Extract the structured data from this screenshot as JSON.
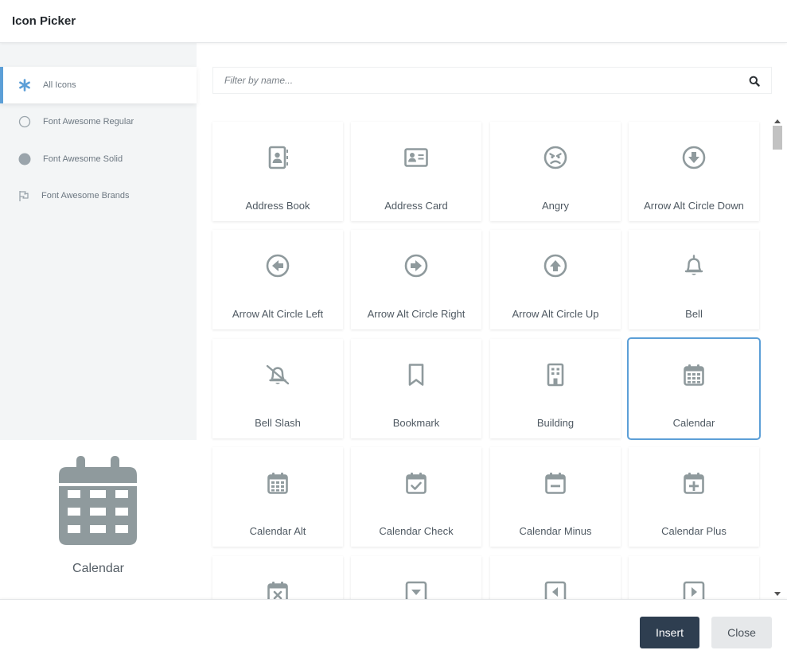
{
  "header": {
    "title": "Icon Picker"
  },
  "sidebar": {
    "items": [
      {
        "label": "All Icons",
        "icon": "asterisk-icon",
        "active": true
      },
      {
        "label": "Font Awesome Regular",
        "icon": "circle-outline-icon",
        "active": false
      },
      {
        "label": "Font Awesome Solid",
        "icon": "circle-solid-icon",
        "active": false
      },
      {
        "label": "Font Awesome Brands",
        "icon": "flag-icon",
        "active": false
      }
    ]
  },
  "preview": {
    "icon": "calendar-icon",
    "name": "Calendar"
  },
  "search": {
    "placeholder": "Filter by name...",
    "value": ""
  },
  "icons": [
    {
      "label": "Address Book",
      "icon": "address-book-icon"
    },
    {
      "label": "Address Card",
      "icon": "address-card-icon"
    },
    {
      "label": "Angry",
      "icon": "angry-icon"
    },
    {
      "label": "Arrow Alt Circle Down",
      "icon": "arrow-alt-circle-down-icon"
    },
    {
      "label": "Arrow Alt Circle Left",
      "icon": "arrow-alt-circle-left-icon"
    },
    {
      "label": "Arrow Alt Circle Right",
      "icon": "arrow-alt-circle-right-icon"
    },
    {
      "label": "Arrow Alt Circle Up",
      "icon": "arrow-alt-circle-up-icon"
    },
    {
      "label": "Bell",
      "icon": "bell-icon"
    },
    {
      "label": "Bell Slash",
      "icon": "bell-slash-icon"
    },
    {
      "label": "Bookmark",
      "icon": "bookmark-icon"
    },
    {
      "label": "Building",
      "icon": "building-icon"
    },
    {
      "label": "Calendar",
      "icon": "calendar-icon",
      "selected": true
    },
    {
      "label": "Calendar Alt",
      "icon": "calendar-alt-icon"
    },
    {
      "label": "Calendar Check",
      "icon": "calendar-check-icon"
    },
    {
      "label": "Calendar Minus",
      "icon": "calendar-minus-icon"
    },
    {
      "label": "Calendar Plus",
      "icon": "calendar-plus-icon"
    },
    {
      "label": "",
      "icon": "calendar-times-icon"
    },
    {
      "label": "",
      "icon": "caret-square-down-icon"
    },
    {
      "label": "",
      "icon": "caret-square-left-icon"
    },
    {
      "label": "",
      "icon": "caret-square-right-icon"
    }
  ],
  "footer": {
    "insert_label": "Insert",
    "close_label": "Close"
  },
  "colors": {
    "accent": "#5c9fd7",
    "icon": "#8f9a9d",
    "primary_button": "#2e3e50",
    "secondary_button": "#e6e8ea",
    "sidebar_bg": "#f3f5f6"
  }
}
